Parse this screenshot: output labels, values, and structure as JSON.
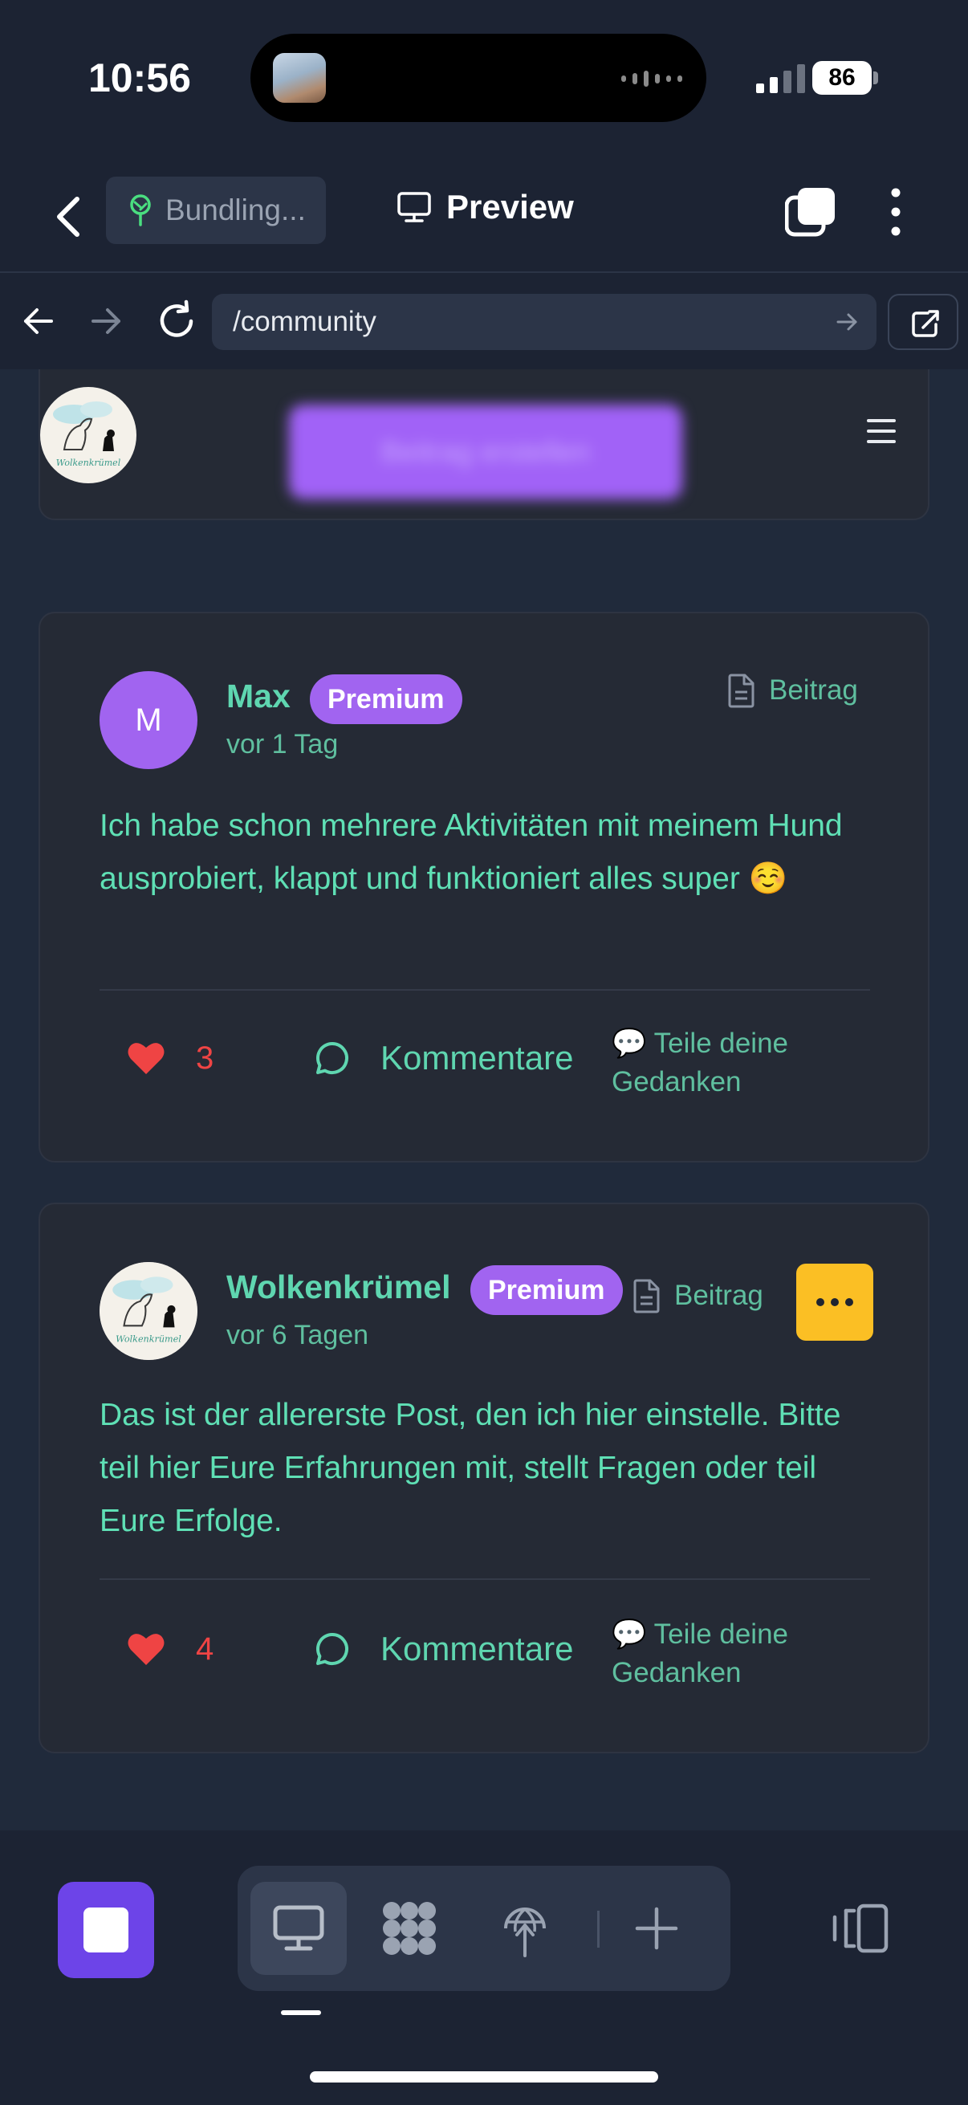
{
  "status_bar": {
    "time": "10:56",
    "battery": "86"
  },
  "app_header": {
    "project_chip": {
      "label": "Bundling...",
      "icon": "tree-icon"
    },
    "preview_label": "Preview"
  },
  "url_bar": {
    "url": "/community"
  },
  "site_header": {
    "logo_text": "Wolkenkrümel",
    "blurred_button": "Beitrag erstellen"
  },
  "posts": [
    {
      "avatar_letter": "M",
      "author": "Max",
      "badge": "Premium",
      "time_ago": "vor 1 Tag",
      "type": "Beitrag",
      "text": "Ich habe schon mehrere Aktivitäten mit meinem Hund ausprobiert, klappt und funktioniert alles super ☺️",
      "likes": "3",
      "comments_label": "Kommentare",
      "share_text": "💬 Teile deine Gedanken"
    },
    {
      "avatar_logo_text": "Wolkenkrümel",
      "author": "Wolkenkrümel",
      "badge": "Premium",
      "time_ago": "vor 6 Tagen",
      "type": "Beitrag",
      "text": "Das ist der allererste Post, den ich hier einstelle. Bitte teil hier Eure Erfahrungen mit, stellt Fragen oder teil Eure Erfolge.",
      "likes": "4",
      "comments_label": "Kommentare",
      "share_text": "💬 Teile deine Gedanken"
    }
  ],
  "colors": {
    "accent_purple": "#a164f0",
    "text_teal": "#5fe0b5",
    "like_red": "#ef4444",
    "more_yellow": "#fbbf24",
    "stop_purple": "#6d44e8"
  }
}
